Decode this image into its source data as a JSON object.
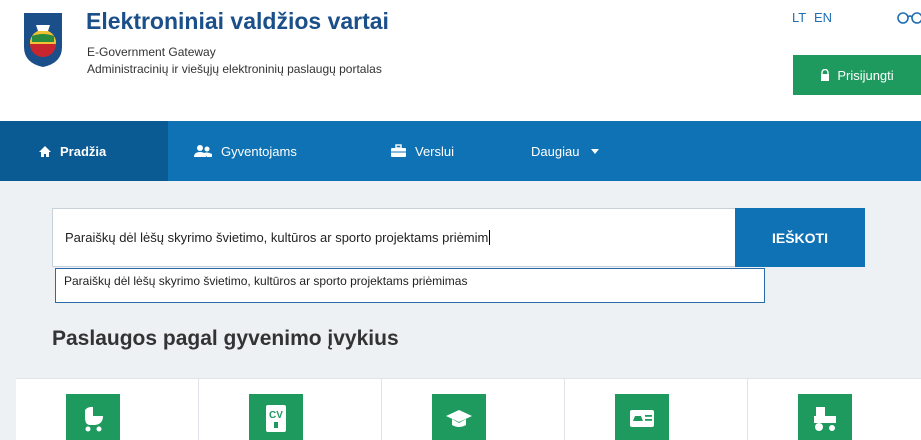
{
  "header": {
    "title": "Elektroniniai valdžios vartai",
    "subtitle": "E-Government Gateway",
    "description": "Administracinių ir viešųjų elektroninių paslaugų portalas",
    "lang_lt": "LT",
    "lang_en": "EN",
    "login_label": "Prisijungti"
  },
  "nav": {
    "items": [
      {
        "label": "Pradžia",
        "icon": "home-icon",
        "active": true
      },
      {
        "label": "Gyventojams",
        "icon": "people-icon"
      },
      {
        "label": "Verslui",
        "icon": "briefcase-icon"
      },
      {
        "label": "Daugiau",
        "icon": "chevron-down-icon"
      }
    ]
  },
  "search": {
    "value": "Paraiškų dėl lėšų skyrimo švietimo, kultūros ar sporto projektams priėmim",
    "button_label": "IEŠKOTI",
    "suggestion": "Paraiškų dėl lėšų skyrimo švietimo, kultūros ar sporto projektams priėmimas"
  },
  "section_title": "Paslaugos pagal gyvenimo įvykius",
  "cards": [
    {
      "icon": "baby-carriage-icon"
    },
    {
      "icon": "cv-icon"
    },
    {
      "icon": "graduation-cap-icon"
    },
    {
      "icon": "driver-license-icon"
    },
    {
      "icon": "tractor-icon"
    }
  ],
  "colors": {
    "brand_blue": "#0f72b4",
    "nav_active": "#0a5a93",
    "green": "#1e9a5f",
    "title_blue": "#1b4f8a"
  }
}
